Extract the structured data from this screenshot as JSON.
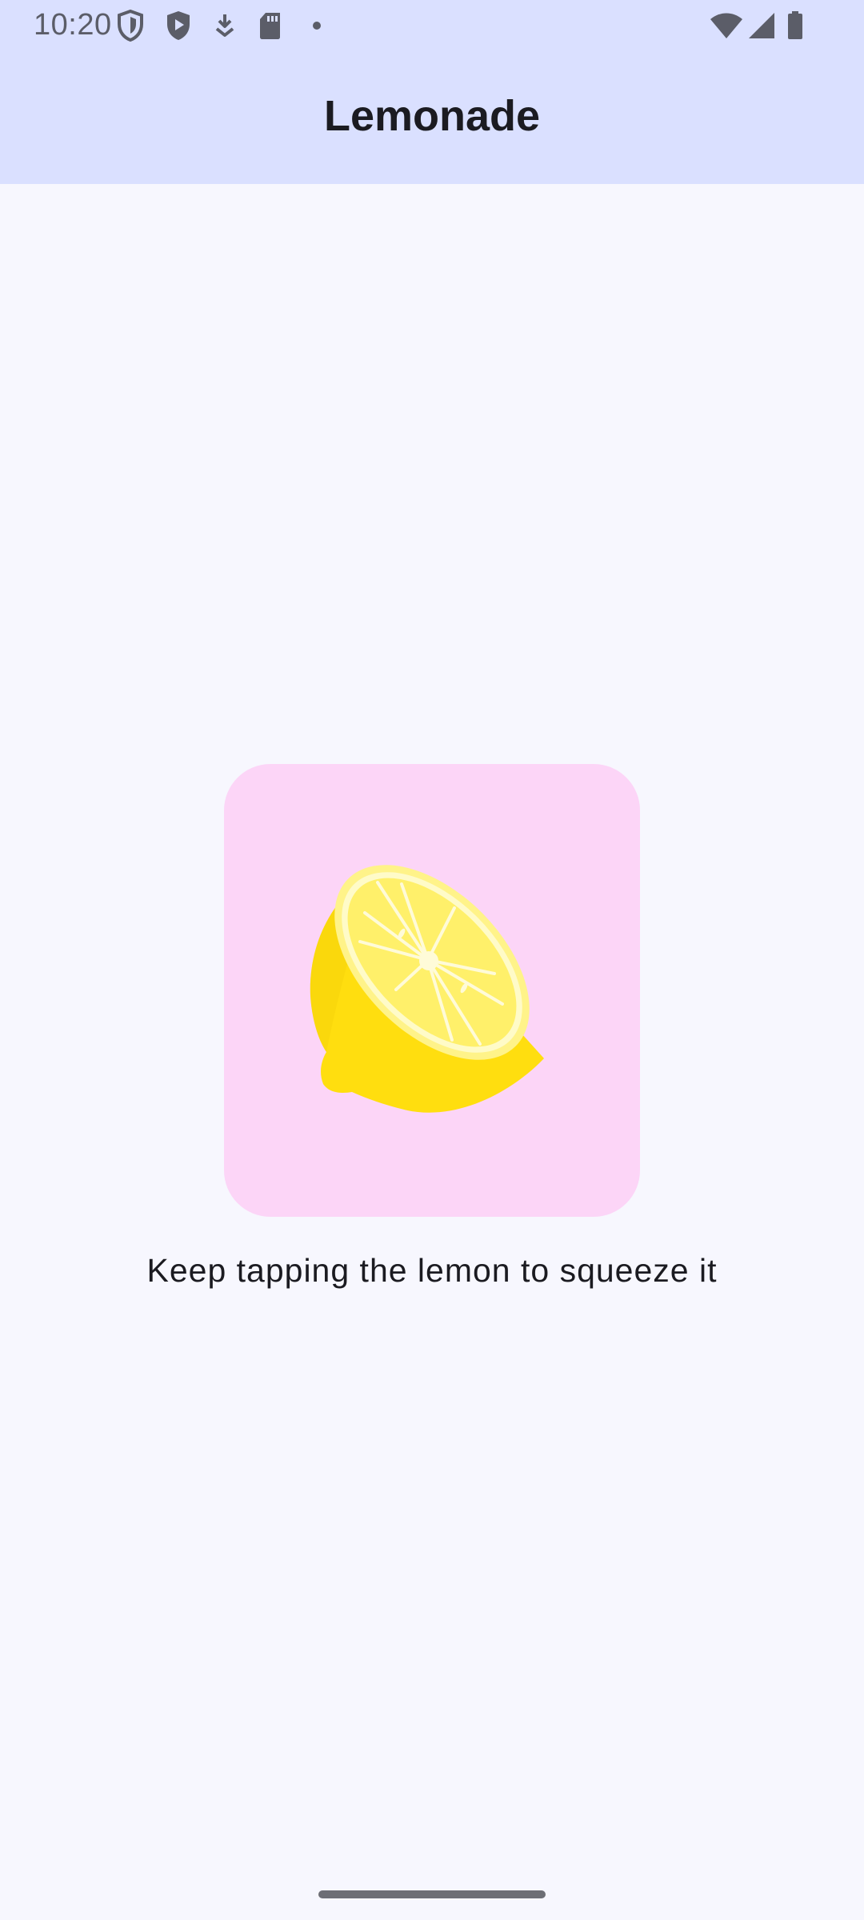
{
  "status_bar": {
    "time": "10:20",
    "icons_left": [
      "shield-outline-icon",
      "play-shield-icon",
      "download-icon",
      "sd-card-icon",
      "notification-dot-icon"
    ],
    "icons_right": [
      "wifi-icon",
      "cellular-signal-icon",
      "battery-icon"
    ]
  },
  "app_bar": {
    "title": "Lemonade"
  },
  "main": {
    "image_name": "squeezed-lemon",
    "instruction": "Keep tapping the lemon to squeeze it"
  },
  "colors": {
    "app_bar_bg": "#dae0ff",
    "page_bg": "#f7f7fe",
    "image_bg": "#fcd5f7",
    "lemon": "#ffde0f"
  }
}
